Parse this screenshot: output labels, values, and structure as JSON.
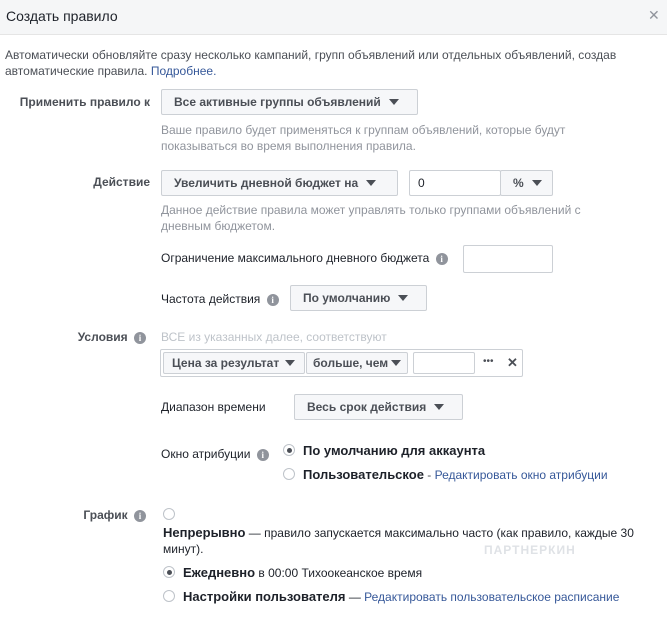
{
  "dialog": {
    "title": "Создать правило",
    "description": "Автоматически обновляйте сразу несколько кампаний, групп объявлений или отдельных объявлений, создав автоматические правила.",
    "learn_more": "Подробнее."
  },
  "apply_rule": {
    "label": "Применить правило к",
    "selected": "Все активные группы объявлений",
    "hint": "Ваше правило будет применяться к группам объявлений, которые будут показываться во время выполнения правила."
  },
  "action": {
    "label": "Действие",
    "selected": "Увеличить дневной бюджет на",
    "value": "0",
    "unit": "%",
    "hint": "Данное действие правила может управлять только группами объявлений с дневным бюджетом.",
    "max_budget_label": "Ограничение максимального дневного бюджета",
    "max_budget_value": "",
    "frequency_label": "Частота действия",
    "frequency_selected": "По умолчанию"
  },
  "conditions": {
    "label": "Условия",
    "match_text": "ВСЕ из указанных далее, соответствуют",
    "metric": "Цена за результат",
    "operator": "больше, чем",
    "value": "",
    "more": "•••",
    "remove": "✕",
    "time_range_label": "Диапазон времени",
    "time_range_selected": "Весь срок действия",
    "attribution_label": "Окно атрибуции",
    "attribution_default": "По умолчанию для аккаунта",
    "attribution_custom": "Пользовательское",
    "attribution_custom_sep": " - ",
    "attribution_edit_link": "Редактировать окно атрибуции"
  },
  "schedule": {
    "label": "График",
    "continuous_title": "Непрерывно",
    "continuous_desc": " — правило запускается максимально часто (как правило, каждые 30 минут).",
    "daily_title": "Ежедневно",
    "daily_desc": " в 00:00 Тихоокеанское время",
    "custom_title": "Настройки пользователя",
    "custom_sep": " — ",
    "custom_link": "Редактировать пользовательское расписание"
  },
  "watermark": "ПАРТНЕРКИН",
  "icons": {
    "info": "info-icon",
    "close": "close-icon",
    "caret": "caret-down-icon"
  },
  "colors": {
    "link": "#365899",
    "label": "#4b4f56",
    "hint": "#90949c",
    "header_bg": "#f5f6f7"
  }
}
